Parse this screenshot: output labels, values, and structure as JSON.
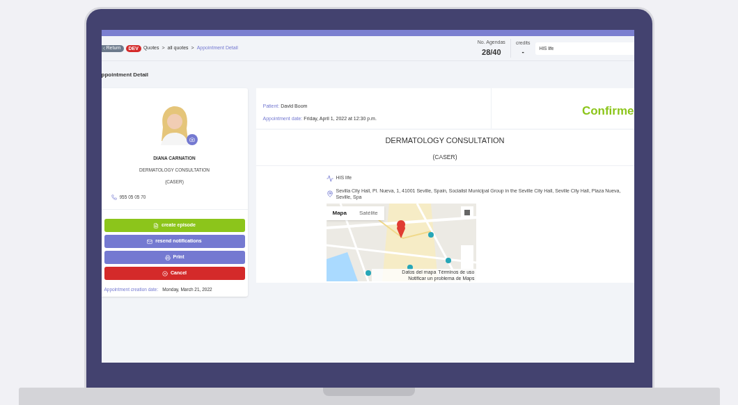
{
  "header": {
    "return_button": "Return",
    "env_badge": "DEV",
    "separator": ">",
    "breadcrumbs": [
      {
        "label": "Quotes",
        "current": false
      },
      {
        "label": "all quotes",
        "current": false
      },
      {
        "label": "Appointment Detail",
        "current": true
      }
    ],
    "agendas": {
      "label": "No. Agendas",
      "value": "28/40"
    },
    "credits": {
      "label": "credits",
      "value": "-"
    },
    "search": {
      "value": "HIS life"
    }
  },
  "page_title": "ppointment Detail",
  "profile": {
    "name": "DIANA CARNATION",
    "specialty": "DERMATOLOGY CONSULTATION",
    "insurer": "(CASER)",
    "phone": "955 05 05 70",
    "actions": [
      {
        "kind": "episode",
        "label": "create episode"
      },
      {
        "kind": "notify",
        "label": "resend notifications"
      },
      {
        "kind": "print",
        "label": "Print"
      },
      {
        "kind": "cancel",
        "label": "Cancel"
      }
    ],
    "created": {
      "label": "Appointment creation date:",
      "value": "Monday, March 21, 2022"
    }
  },
  "appointment": {
    "patient": {
      "label": "Patient:",
      "value": "David Boom"
    },
    "date": {
      "label": "Appointment date:",
      "value": "Friday, April 1, 2022 at 12:30 p.m."
    },
    "status": "Confirme",
    "service": "DERMATOLOGY CONSULTATION",
    "insurer": "(CASER)",
    "center": "HIS life",
    "address": "Sevilla City Hall, Pl. Nueva, 1, 41001 Seville, Spain, Socialist Municipal Group in the Seville City Hall, Seville City Hall, Plaza Nueva, Seville, Spa",
    "map": {
      "kind": "picture",
      "types": [
        {
          "label": "Mapa",
          "selected": true
        },
        {
          "label": "Satélite",
          "selected": false
        }
      ],
      "footer": [
        "Datos del mapa",
        "Términos de uso",
        "Notificar un problema de Maps"
      ]
    }
  }
}
